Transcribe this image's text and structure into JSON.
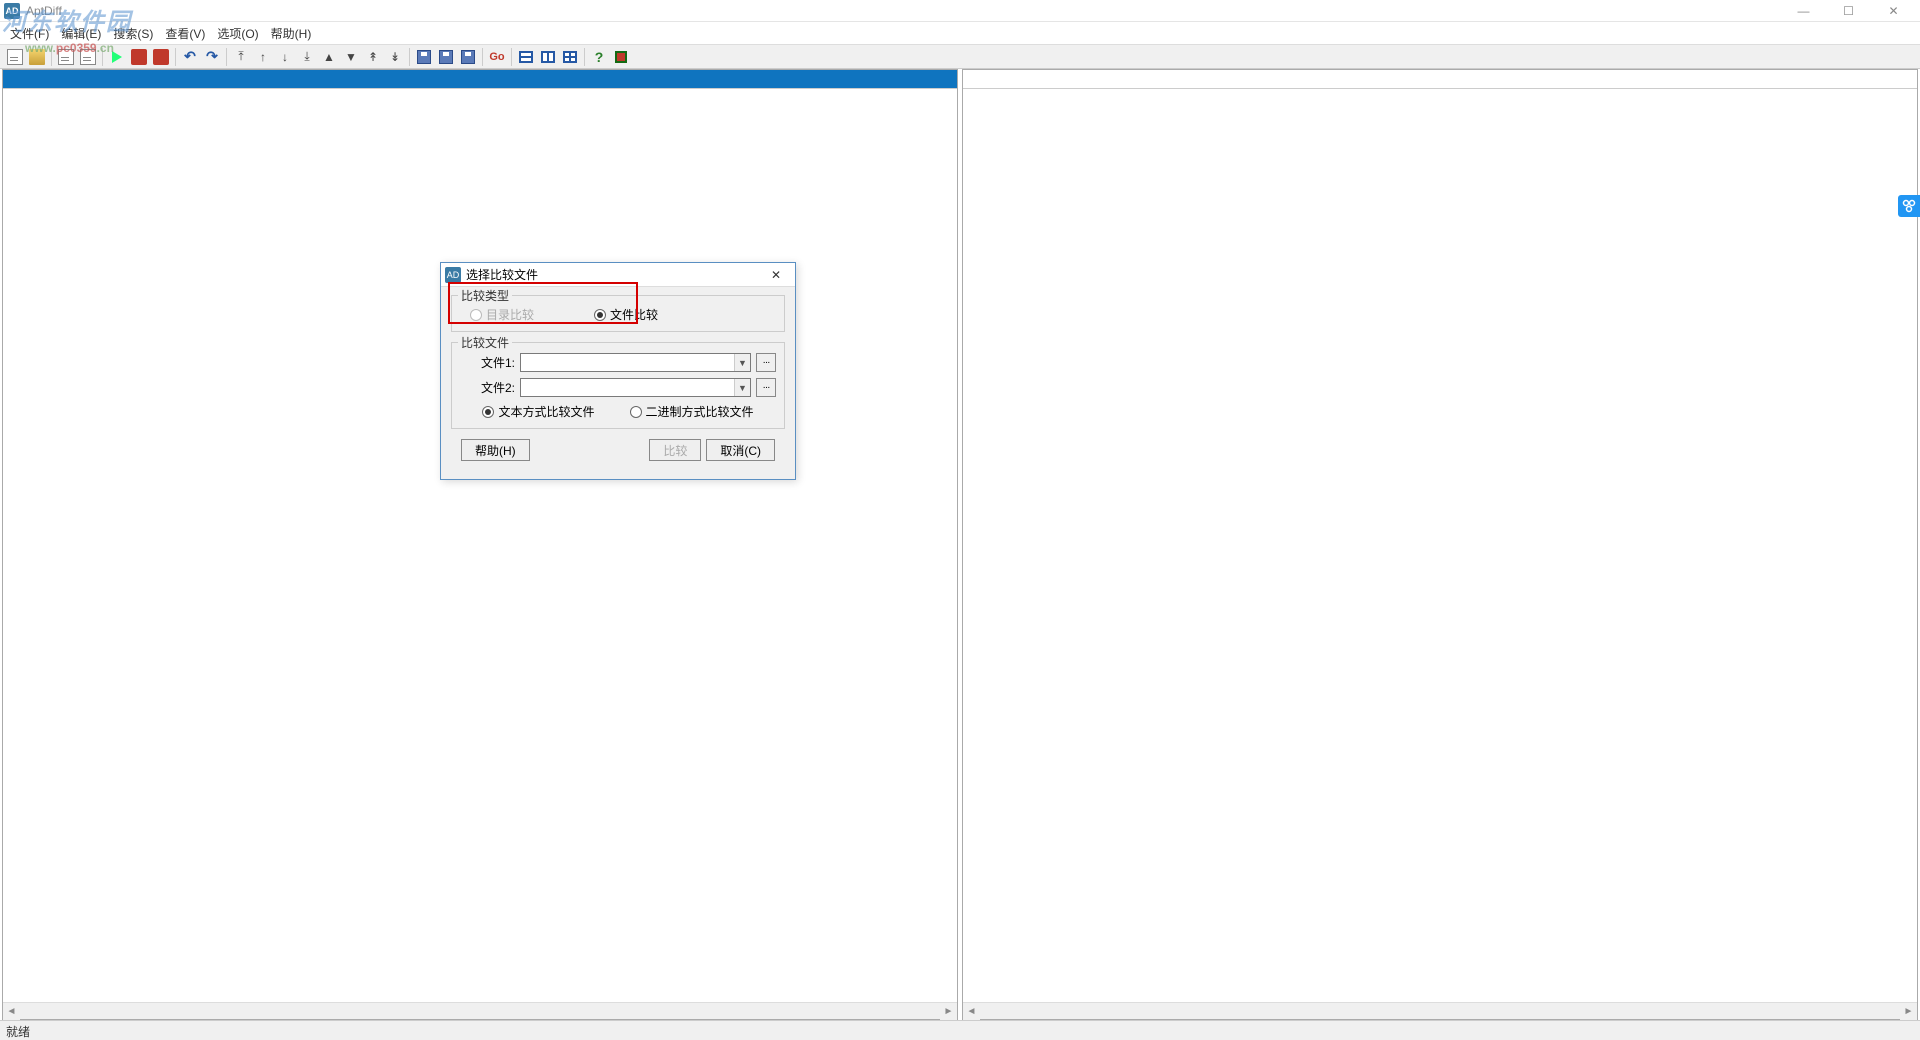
{
  "window": {
    "title": "AptDiff"
  },
  "watermark": {
    "text1": "河东软件园",
    "text2_a": "www.",
    "text2_b": "pc0359",
    "text2_c": ".cn"
  },
  "menu": [
    "文件(F)",
    "编辑(E)",
    "搜索(S)",
    "查看(V)",
    "选项(O)",
    "帮助(H)"
  ],
  "status": "就绪",
  "dialog": {
    "title": "选择比较文件",
    "group1": {
      "legend": "比较类型",
      "opt_dir": "目录比较",
      "opt_file": "文件比较"
    },
    "group2": {
      "legend": "比较文件",
      "file1_label": "文件1:",
      "file2_label": "文件2:",
      "method_text": "文本方式比较文件",
      "method_bin": "二进制方式比较文件"
    },
    "buttons": {
      "help": "帮助(H)",
      "compare": "比较",
      "cancel": "取消(C)"
    }
  }
}
